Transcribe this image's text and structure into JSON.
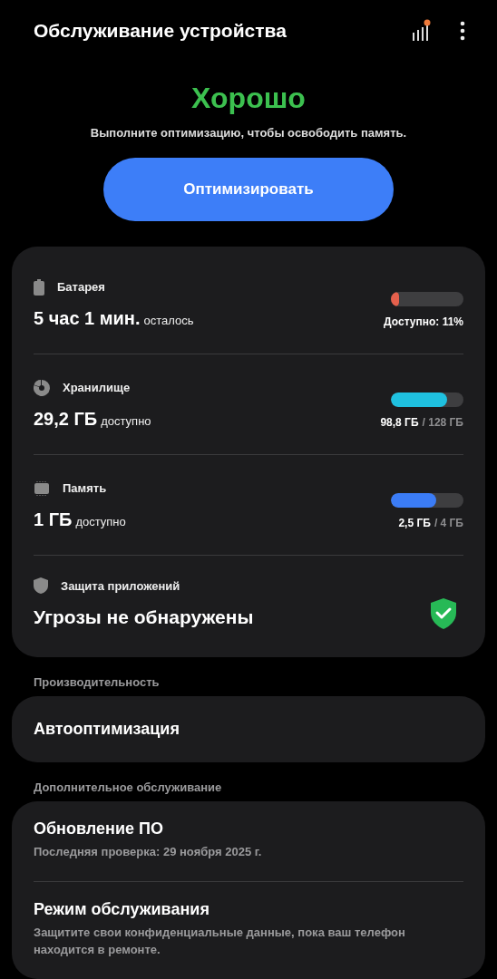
{
  "header": {
    "title": "Обслуживание устройства"
  },
  "status": {
    "text": "Хорошо",
    "color": "#3cc04f",
    "message": "Выполните оптимизацию, чтобы освободить память."
  },
  "optimize_button": "Оптимизировать",
  "summary": [
    {
      "kind": "bar",
      "label": "Батарея",
      "value": "5 час 1 мин.",
      "suffix": "осталось",
      "level": 0.11,
      "color": "#e5604c",
      "reading": "Доступно: 11%"
    },
    {
      "kind": "bar",
      "label": "Хранилище",
      "value": "29,2 ГБ",
      "suffix": "доступно",
      "level": 0.77,
      "color": "#1fc1e0",
      "used": "98,8 ГБ",
      "total": "/ 128 ГБ"
    },
    {
      "kind": "bar",
      "label": "Память",
      "value": "1 ГБ",
      "suffix": "доступно",
      "level": 0.625,
      "color": "#3b7cf6",
      "used": "2,5 ГБ",
      "total": "/ 4 ГБ"
    },
    {
      "kind": "shield",
      "label": "Защита приложений",
      "value": "Угрозы не обнаружены"
    }
  ],
  "sections": [
    {
      "title": "Производительность",
      "items": [
        {
          "title": "Автооптимизация"
        }
      ]
    },
    {
      "title": "Дополнительное обслуживание",
      "items": [
        {
          "title": "Обновление ПО",
          "subtitle": "Последняя проверка: 29 ноября 2025 г."
        },
        {
          "title": "Режим обслуживания",
          "subtitle": "Защитите свои конфиденциальные данные, пока ваш телефон находится в ремонте."
        }
      ]
    }
  ]
}
